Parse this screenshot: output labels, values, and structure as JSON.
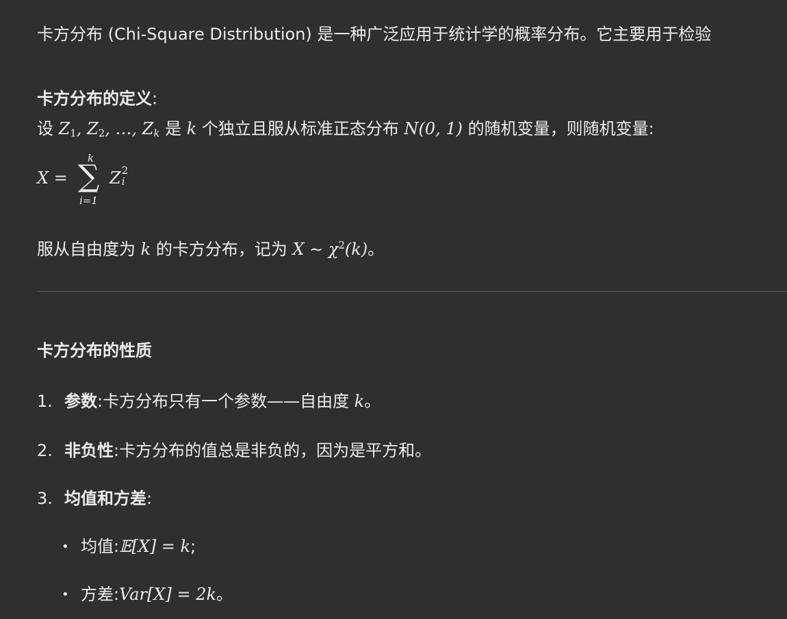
{
  "intro": {
    "text": "卡方分布 (Chi-Square Distribution) 是一种广泛应用于统计学的概率分布。它主要用于检验"
  },
  "definition": {
    "heading": "卡方分布的定义",
    "colon": ":",
    "line1_prefix": "设 ",
    "vars_z1": "Z",
    "vars_z1_sub": "1",
    "vars_sep1": ", ",
    "vars_z2": "Z",
    "vars_z2_sub": "2",
    "vars_sep2": ", …, ",
    "vars_zk": "Z",
    "vars_zk_sub": "k",
    "line1_mid1": " 是 ",
    "k1": "k",
    "line1_mid2": " 个独立且服从标准正态分布 ",
    "normal": "N(0, 1)",
    "line1_end": " 的随机变量，则随机变量:",
    "formula_lhs": "X =",
    "formula_upper": "k",
    "formula_sigma": "∑",
    "formula_lower": "i=1",
    "formula_term": "Z",
    "formula_term_sub": "i",
    "formula_term_sup": "2",
    "line2_prefix": "服从自由度为 ",
    "k2": "k",
    "line2_mid": " 的卡方分布，记为 ",
    "notation": "X ∼ χ",
    "notation_sup": "2",
    "notation_arg": "(k)",
    "line2_end": "。"
  },
  "properties": {
    "heading": "卡方分布的性质",
    "items": [
      {
        "num": "1.",
        "label": "参数",
        "colon": ":",
        "text": "卡方分布只有一个参数——自由度 ",
        "math": "k",
        "end": "。"
      },
      {
        "num": "2.",
        "label": "非负性",
        "colon": ":",
        "text": "卡方分布的值总是非负的，因为是平方和。",
        "math": "",
        "end": ""
      },
      {
        "num": "3.",
        "label": "均值和方差",
        "colon": ":",
        "text": "",
        "math": "",
        "end": ""
      }
    ],
    "bullets": [
      {
        "dot": "•",
        "label": "均值:",
        "math_pre": "𝔼",
        "math": "[X] = k",
        "end": ";"
      },
      {
        "dot": "•",
        "label": "方差:",
        "math_pre": "Var",
        "math": "[X] = 2k",
        "end": "。"
      }
    ]
  }
}
